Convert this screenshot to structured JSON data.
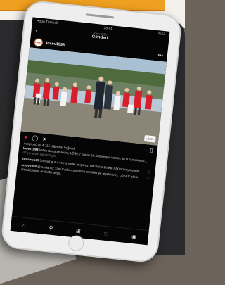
{
  "status_bar": {
    "carrier": "••ooo Turkcell",
    "time": "18:41",
    "battery": "%52"
  },
  "nav": {
    "account": "losev1998",
    "title": "Gönderi"
  },
  "post": {
    "account": "losev1998",
    "logo_text": "LÖSEV",
    "likes_text": "adegroo0 ve 4.715 diğer kişi beğendi",
    "caption_user": "losev1998",
    "caption_text": "Vatan Kurtaran Ruhu, LÖSEV olarak 16.500 kişiyle Atatürk'ün huzurundayız...",
    "view_comments": "47 yorumun tümünü gör",
    "comments": [
      {
        "user": "kulisweb35",
        "text": "Sonsuz gurur ve minnetle anıyoruz, bir olalım birlikte Ata'mızın yolunda"
      },
      {
        "user": "losev1998",
        "text": "@nurdan52 Tüm Katılımcılarımıza tebrikler ve teşekkürler, LÖSEV ailesi olarak birlikte Anıtkabir'deyiz."
      }
    ]
  },
  "icons": {
    "back": "back-arrow-icon",
    "more": "more-options-icon",
    "like": "heart-icon",
    "comment": "comment-icon",
    "share": "send-icon",
    "save": "bookmark-icon",
    "home": "home-icon",
    "search": "search-icon",
    "add": "add-post-icon",
    "activity": "heart-outline-icon",
    "profile": "profile-icon"
  },
  "colors": {
    "accent": "#f0a020",
    "screen_bg": "#050505",
    "card_bg": "#2b2b2d"
  }
}
